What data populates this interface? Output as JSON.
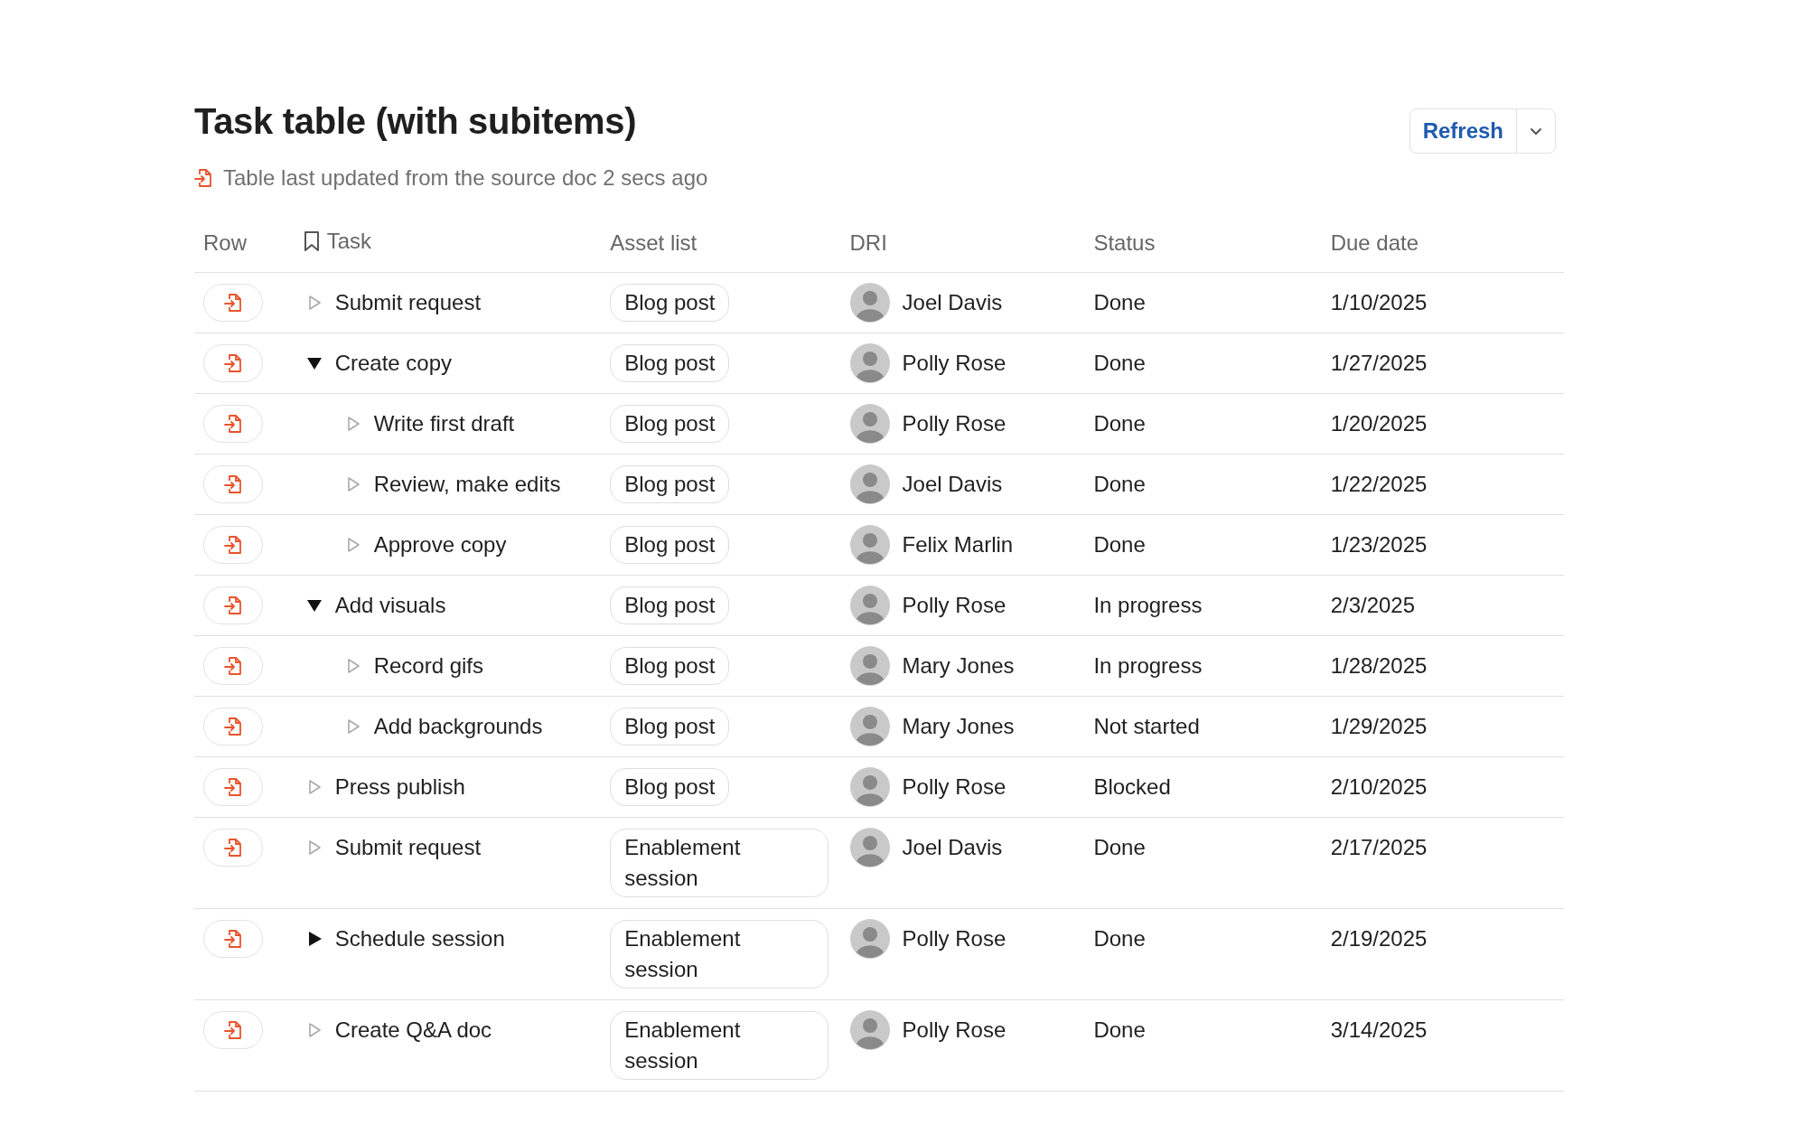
{
  "title": "Task table (with subitems)",
  "sync_note": "Table last updated from the source doc 2 secs ago",
  "refresh_button": {
    "label": "Refresh"
  },
  "table": {
    "columns": [
      "Row",
      "Task",
      "Asset list",
      "DRI",
      "Status",
      "Due date"
    ],
    "rows": [
      {
        "task": "Submit request",
        "kind": "leaf",
        "asset": "Blog post",
        "dri": "Joel Davis",
        "status": "Done",
        "due": "1/10/2025"
      },
      {
        "task": "Create copy",
        "kind": "parent",
        "expanded": true,
        "asset": "Blog post",
        "dri": "Polly Rose",
        "status": "Done",
        "due": "1/27/2025",
        "children": [
          {
            "task": "Write first draft",
            "kind": "leaf",
            "asset": "Blog post",
            "dri": "Polly Rose",
            "status": "Done",
            "due": "1/20/2025"
          },
          {
            "task": "Review, make edits",
            "kind": "leaf",
            "asset": "Blog post",
            "dri": "Joel Davis",
            "status": "Done",
            "due": "1/22/2025"
          },
          {
            "task": "Approve copy",
            "kind": "leaf",
            "asset": "Blog post",
            "dri": "Felix Marlin",
            "status": "Done",
            "due": "1/23/2025"
          }
        ]
      },
      {
        "task": "Add visuals",
        "kind": "parent",
        "expanded": true,
        "asset": "Blog post",
        "dri": "Polly Rose",
        "status": "In progress",
        "due": "2/3/2025",
        "children": [
          {
            "task": "Record gifs",
            "kind": "leaf",
            "asset": "Blog post",
            "dri": "Mary Jones",
            "status": "In progress",
            "due": "1/28/2025"
          },
          {
            "task": "Add backgrounds",
            "kind": "leaf",
            "asset": "Blog post",
            "dri": "Mary Jones",
            "status": "Not started",
            "due": "1/29/2025"
          }
        ]
      },
      {
        "task": "Press publish",
        "kind": "leaf",
        "asset": "Blog post",
        "dri": "Polly Rose",
        "status": "Blocked",
        "due": "2/10/2025"
      },
      {
        "task": "Submit request",
        "kind": "leaf",
        "asset": "Enablement session",
        "dri": "Joel Davis",
        "status": "Done",
        "due": "2/17/2025"
      },
      {
        "task": "Schedule session",
        "kind": "parent",
        "expanded": false,
        "asset": "Enablement session",
        "dri": "Polly Rose",
        "status": "Done",
        "due": "2/19/2025"
      },
      {
        "task": "Create Q&A doc",
        "kind": "leaf",
        "asset": "Enablement session",
        "dri": "Polly Rose",
        "status": "Done",
        "due": "3/14/2025"
      }
    ]
  }
}
